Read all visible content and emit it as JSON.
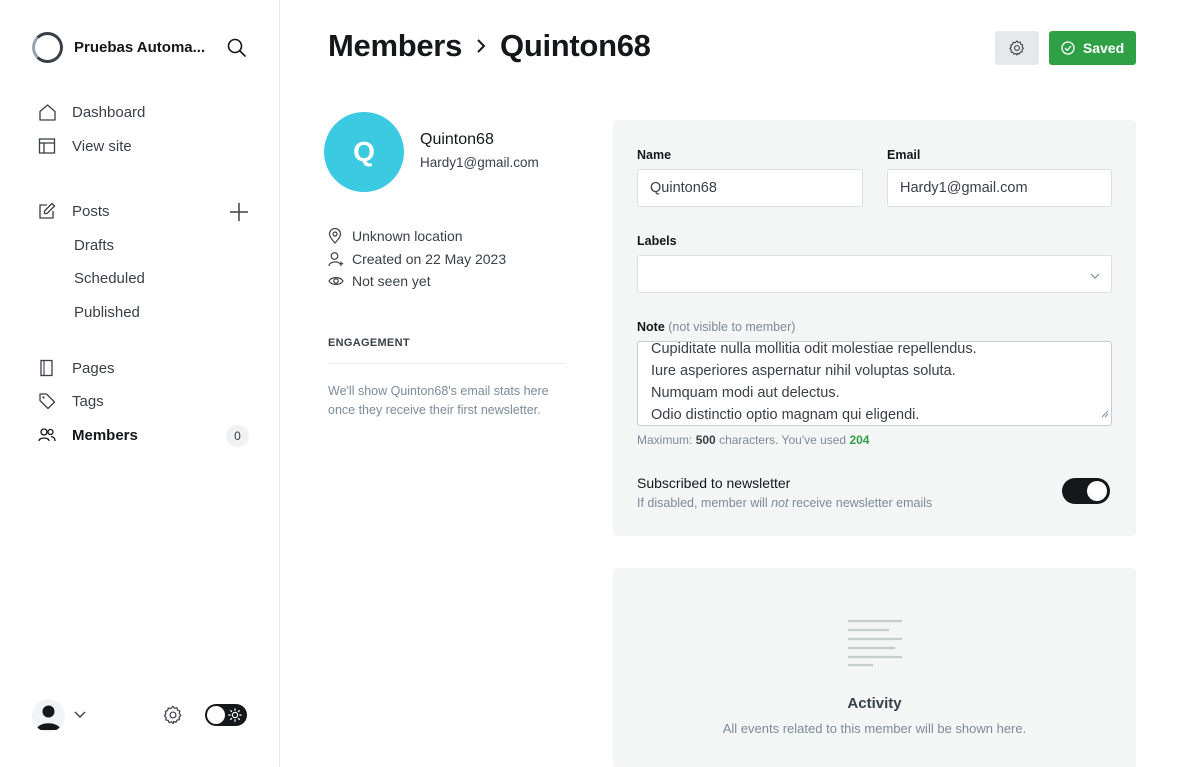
{
  "site": {
    "name": "Pruebas Automa..."
  },
  "nav": {
    "dashboard": "Dashboard",
    "view_site": "View site",
    "posts": "Posts",
    "drafts": "Drafts",
    "scheduled": "Scheduled",
    "published": "Published",
    "pages": "Pages",
    "tags": "Tags",
    "members": "Members",
    "members_count": "0"
  },
  "header": {
    "section": "Members",
    "member": "Quinton68",
    "saved_label": "Saved"
  },
  "profile": {
    "initial": "Q",
    "name": "Quinton68",
    "email": "Hardy1@gmail.com",
    "location": "Unknown location",
    "created": "Created on 22 May 2023",
    "seen": "Not seen yet"
  },
  "engagement": {
    "title": "ENGAGEMENT",
    "text": "We'll show Quinton68's email stats here once they receive their first newsletter."
  },
  "form": {
    "name_label": "Name",
    "name_value": "Quinton68",
    "email_label": "Email",
    "email_value": "Hardy1@gmail.com",
    "labels_label": "Labels",
    "note_label": "Note",
    "note_hint": "(not visible to member)",
    "note_lines": [
      "Cupiditate nulla mollitia odit molestiae repellendus.",
      "Iure asperiores aspernatur nihil voluptas soluta.",
      "Numquam modi aut delectus.",
      "Odio distinctio optio magnam qui eligendi."
    ],
    "counter_prefix": "Maximum:",
    "counter_max": "500",
    "counter_mid": "characters. You've used",
    "counter_used": "204",
    "newsletter_title": "Subscribed to newsletter",
    "newsletter_desc_1": "If disabled, member will",
    "newsletter_desc_em": "not",
    "newsletter_desc_2": "receive newsletter emails",
    "newsletter_enabled": true
  },
  "activity": {
    "title": "Activity",
    "text": "All events related to this member will be shown here."
  },
  "colors": {
    "accent_green": "#30a046",
    "avatar": "#3cc9e2",
    "card_bg": "#f4f5f5"
  }
}
